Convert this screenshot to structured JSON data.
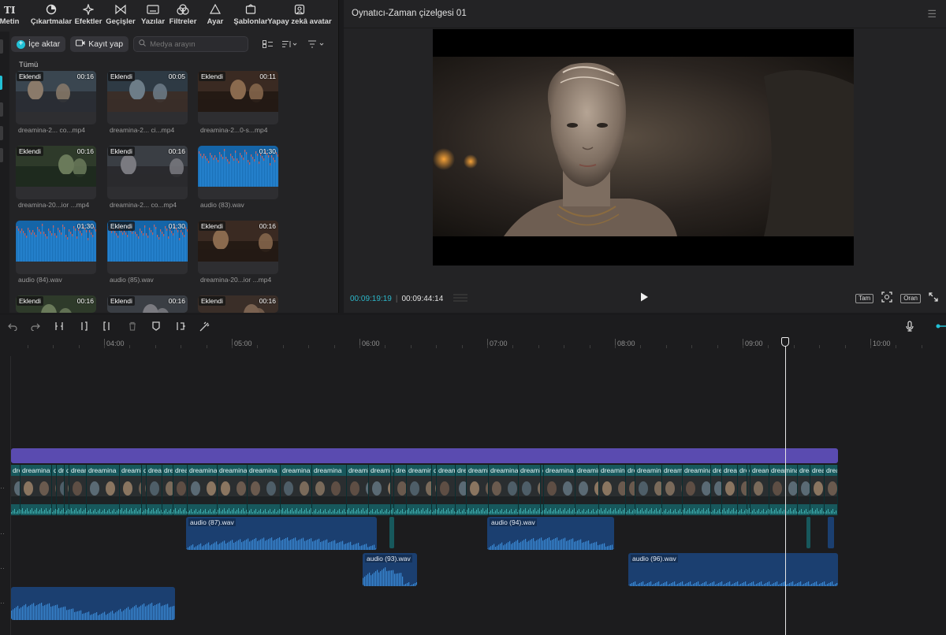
{
  "tabs": [
    {
      "label": "Metin",
      "icon": "text-icon"
    },
    {
      "label": "Çıkartmalar",
      "icon": "sticker-icon"
    },
    {
      "label": "Efektler",
      "icon": "sparkle-icon"
    },
    {
      "label": "Geçişler",
      "icon": "transition-icon"
    },
    {
      "label": "Yazılar",
      "icon": "caption-icon"
    },
    {
      "label": "Filtreler",
      "icon": "filter-icon"
    },
    {
      "label": "Ayar",
      "icon": "adjust-icon"
    },
    {
      "label": "Şablonlar",
      "icon": "template-icon"
    },
    {
      "label": "Yapay zekâ avatar",
      "icon": "avatar-icon"
    }
  ],
  "media": {
    "import_label": "İçe aktar",
    "record_label": "Kayıt yap",
    "search_placeholder": "Medya arayın",
    "section_label": "Tümü",
    "items": [
      {
        "badge": "Eklendi",
        "duration": "00:16",
        "name": "dreamina-2... co...mp4",
        "kind": "video"
      },
      {
        "badge": "Eklendi",
        "duration": "00:05",
        "name": "dreamina-2... ci...mp4",
        "kind": "video"
      },
      {
        "badge": "Eklendi",
        "duration": "00:11",
        "name": "dreamina-2...0-s...mp4",
        "kind": "video"
      },
      {
        "badge": "Eklendi",
        "duration": "00:16",
        "name": "dreamina-20...ior ...mp4",
        "kind": "video"
      },
      {
        "badge": "Eklendi",
        "duration": "00:16",
        "name": "dreamina-2... co...mp4",
        "kind": "video"
      },
      {
        "badge": "",
        "duration": "01:30",
        "name": "audio (83).wav",
        "kind": "audio"
      },
      {
        "badge": "",
        "duration": "01:30",
        "name": "audio (84).wav",
        "kind": "audio"
      },
      {
        "badge": "Eklendi",
        "duration": "01:30",
        "name": "audio (85).wav",
        "kind": "audio"
      },
      {
        "badge": "Eklendi",
        "duration": "00:16",
        "name": "dreamina-20...ior ...mp4",
        "kind": "video"
      },
      {
        "badge": "Eklendi",
        "duration": "00:16",
        "name": "",
        "kind": "video"
      },
      {
        "badge": "Eklendi",
        "duration": "00:16",
        "name": "",
        "kind": "video"
      },
      {
        "badge": "Eklendi",
        "duration": "00:16",
        "name": "",
        "kind": "video"
      }
    ]
  },
  "player": {
    "title": "Oynatıcı-Zaman çizelgesi 01",
    "current_time": "00:09:19:19",
    "total_time": "00:09:44:14",
    "full_label": "Tam",
    "ratio_label": "Oran"
  },
  "timeline": {
    "ruler": [
      "04:00",
      "05:00",
      "06:00",
      "07:00",
      "08:00",
      "09:00",
      "10:00"
    ],
    "video_clip_label": "dreamina",
    "audio_clips": [
      {
        "label": "audio (87).wav"
      },
      {
        "label": "audio (94).wav"
      },
      {
        "label": "audio (93).wav"
      },
      {
        "label": "audio (96).wav"
      },
      {
        "label": ""
      }
    ]
  },
  "colors": {
    "accent": "#22c1d6",
    "video_track": "#17585c",
    "audio_clip": "#1b3f70",
    "effect_bar": "#5a4bb0",
    "audio_wave": "#3a8ad6"
  }
}
